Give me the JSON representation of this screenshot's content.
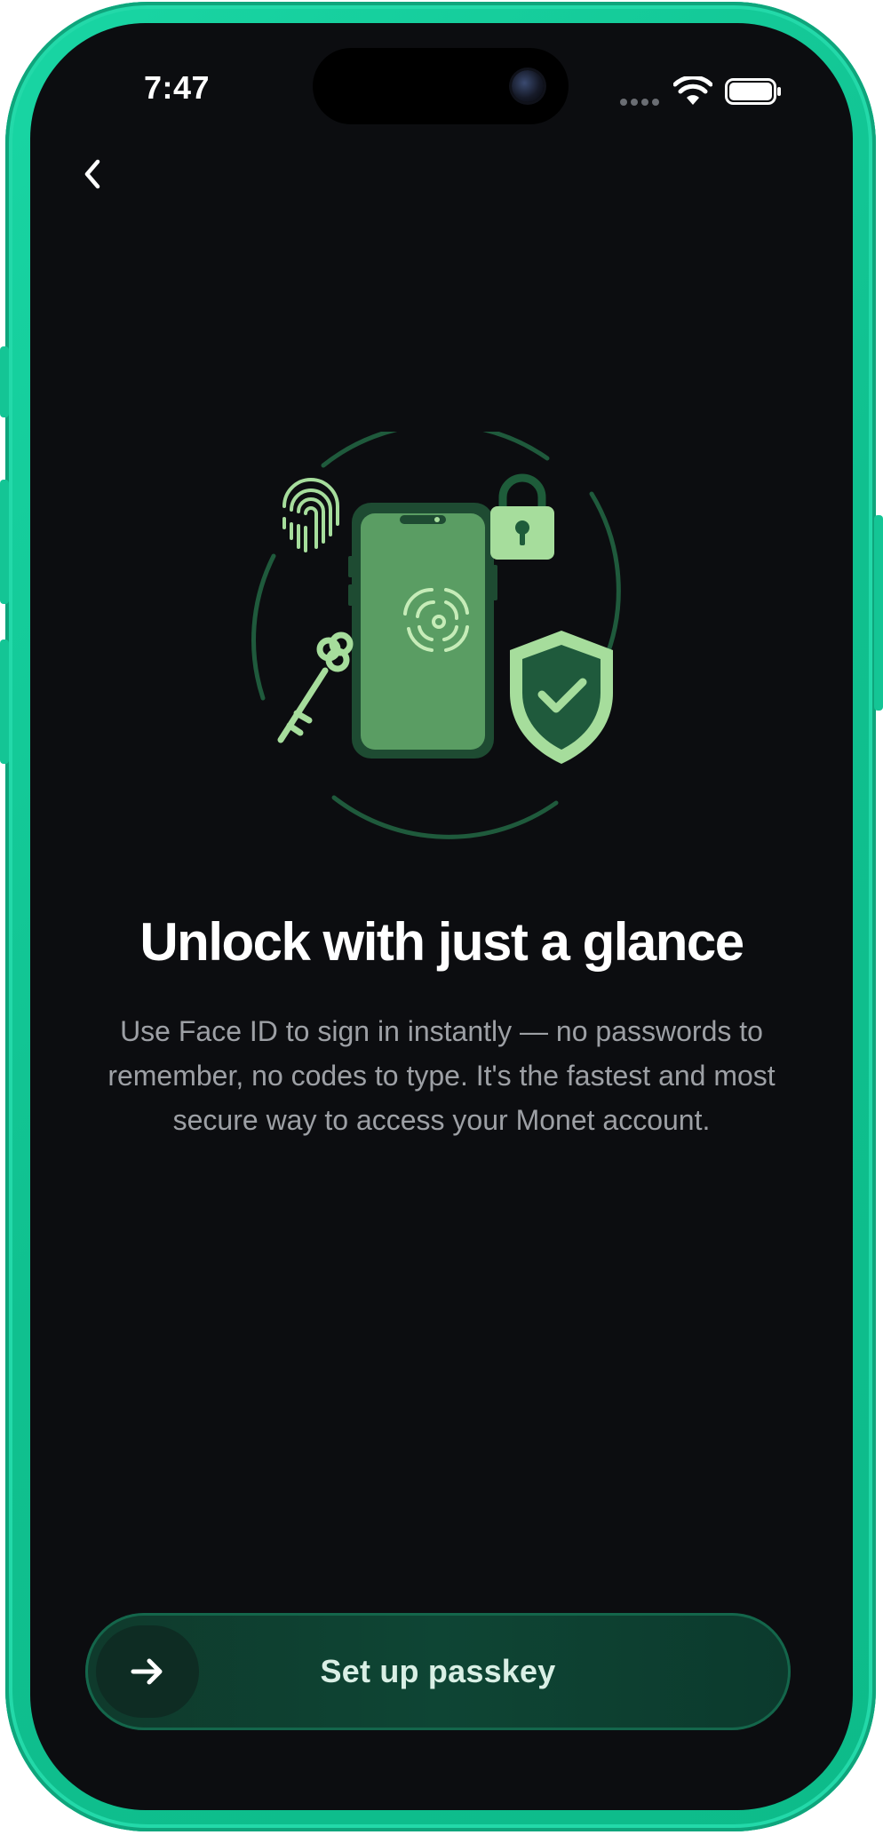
{
  "status_bar": {
    "time": "7:47"
  },
  "navigation": {
    "back_icon": "chevron-left-icon"
  },
  "illustration": {
    "icons": [
      "fingerprint-icon",
      "phone-icon",
      "face-scan-icon",
      "padlock-icon",
      "key-icon",
      "shield-check-icon"
    ]
  },
  "content": {
    "title": "Unlock with just a glance",
    "description": "Use Face ID to sign in instantly — no passwords to remember, no codes to type. It's the fastest and most secure way to access your Monet account."
  },
  "cta": {
    "label": "Set up passkey",
    "icon": "arrow-right-icon"
  },
  "colors": {
    "frame": "#10c08f",
    "background": "#0c0d10",
    "accent_green": "#a6dd9c",
    "dark_green": "#1d5a3a",
    "button_bg": "#0e4534"
  }
}
